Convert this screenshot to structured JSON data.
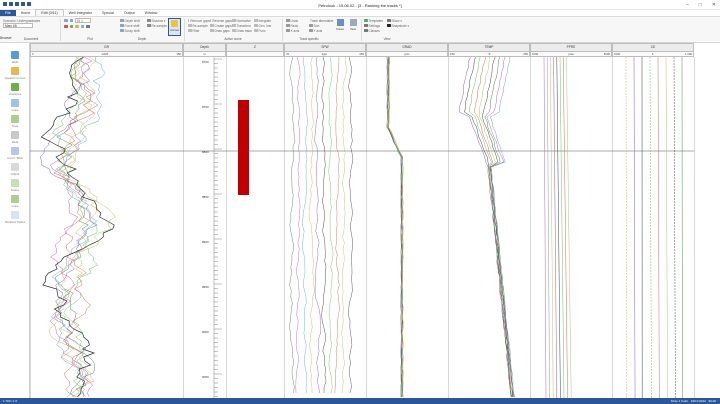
{
  "window": {
    "title": "Petrolook - 15.06.02 - [3 - Ranking the tracks *]"
  },
  "menu": {
    "tabs": [
      {
        "label": "File"
      },
      {
        "label": "Home"
      },
      {
        "label": "Edit (3/11)"
      },
      {
        "label": "Well Integrator"
      },
      {
        "label": "Special"
      },
      {
        "label": "Output"
      },
      {
        "label": "Window"
      }
    ]
  },
  "ribbon": {
    "scenario_label": "Scenario: Undergraduates",
    "scenario_value": "Main 4B",
    "zoom_value": "Dt 1",
    "groups": [
      "Document",
      "Plot",
      "Depth",
      "Active curve",
      "Track specific",
      "View"
    ],
    "depth_items": [
      "Depth shift",
      "Force shift",
      "Scrap shift",
      "Shadow ▾",
      "Re-sample"
    ],
    "active_curve_items": [
      "Remove gaps",
      "Re-sample",
      "Filter",
      "Reverse gaps",
      "Create gaps",
      "Draw gaps",
      "Normalise",
      "Transform",
      "Draw trace",
      "Integrate",
      "Gen. line",
      "Func"
    ],
    "track_items": [
      "Undo",
      "Redo",
      "Track alternative",
      "Sort",
      "X axis",
      "Y axis"
    ],
    "view_items": [
      "Templates",
      "Settings",
      "Show ▾",
      "Snapshots ▾",
      "Classes"
    ],
    "single_buttons": [
      "Curves",
      "Plot",
      "Colour",
      "View"
    ]
  },
  "panel": {
    "title": "Browser",
    "col2": "Document"
  },
  "sidebar": {
    "items": [
      "Wells",
      "Question Curves",
      "Linestyles",
      "Lines",
      "Tools",
      "Pads",
      "Correl. Table",
      "Output",
      "Scales",
      "Lines",
      "Workflow Tables"
    ]
  },
  "tracks": [
    {
      "name": "GR",
      "unit": "GAPI",
      "min": "0",
      "max": "150"
    },
    {
      "name": "Depth",
      "unit": "m",
      "min": "",
      "max": ""
    },
    {
      "name": "Z",
      "unit": "",
      "min": "",
      "max": ""
    },
    {
      "name": "SPW",
      "unit": "kgw",
      "min": "70",
      "max": "250"
    },
    {
      "name": "GRAD",
      "unit": "g/cc",
      "min": "",
      "max": ""
    },
    {
      "name": "TEMP",
      "unit": "°F",
      "min": "150",
      "max": "250"
    },
    {
      "name": "PPRE",
      "unit": "psia",
      "min": "1000",
      "max": "6000"
    },
    {
      "name": "CE",
      "unit": "ft",
      "min": "1000",
      "max": "1 000"
    }
  ],
  "depth_labels": [
    "8700",
    "8750",
    "8800",
    "8850",
    "8900",
    "8950",
    "9000",
    "9050"
  ],
  "status": {
    "left": "1 700 / 1 ft",
    "right": "Xtras 1 Color · 100 0.0012 · 96.00"
  },
  "colors": {
    "accent": "#2b579a",
    "zone": "#c00000",
    "track_header": "#ececec"
  }
}
